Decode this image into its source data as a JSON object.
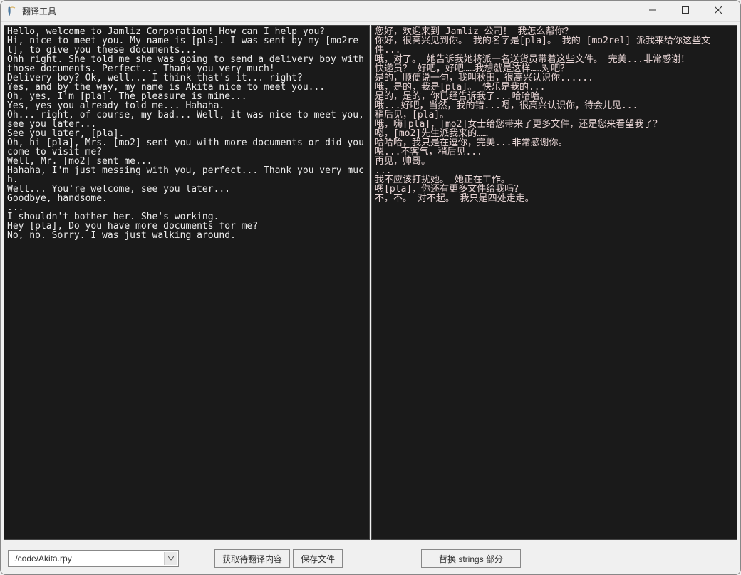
{
  "window": {
    "title": "翻译工具"
  },
  "panels": {
    "left_text": "Hello, welcome to Jamliz Corporation! How can I help you?\nHi, nice to meet you. My name is [pla]. I was sent by my [mo2rel], to give you these documents...\nOhh right. She told me she was going to send a delivery boy with those documents. Perfect... Thank you very much!\nDelivery boy? Ok, well... I think that's it... right?\nYes, and by the way, my name is Akita nice to meet you...\nOh, yes, I'm [pla]. The pleasure is mine...\nYes, yes you already told me... Hahaha.\nOh... right, of course, my bad... Well, it was nice to meet you, see you later...\nSee you later, [pla].\nOh, hi [pla], Mrs. [mo2] sent you with more documents or did you come to visit me?\nWell, Mr. [mo2] sent me...\nHahaha, I'm just messing with you, perfect... Thank you very much.\nWell... You're welcome, see you later...\nGoodbye, handsome.\n...\nI shouldn't bother her. She's working.\nHey [pla], Do you have more documents for me?\nNo, no. Sorry. I was just walking around.",
    "right_text": "您好，欢迎来到 Jamliz 公司！ 我怎么帮你？\n你好，很高兴见到你。 我的名字是[pla]。 我的 [mo2rel] 派我来给你这些文件...\n哦，对了。 她告诉我她将派一名送货员带着这些文件。 完美...非常感谢！\n快递员？ 好吧，好吧……我想就是这样……对吧？\n是的，顺便说一句，我叫秋田，很高兴认识你......\n哦，是的，我是[pla]。 快乐是我的...\n是的，是的，你已经告诉我了...哈哈哈。\n哦...好吧，当然，我的错...嗯，很高兴认识你，待会儿见...\n稍后见，[pla]。\n哦，嗨[pla]，[mo2]女士给您带来了更多文件，还是您来看望我了？\n嗯，[mo2]先生派我来的……\n哈哈哈，我只是在逗你，完美...非常感谢你。\n嗯...不客气，稍后见...\n再见，帅哥。\n...\n我不应该打扰她。 她正在工作。\n嘿[pla]，你还有更多文件给我吗？\n不，不。 对不起。 我只是四处走走。"
  },
  "bottom": {
    "file_path": "./code/Akita.rpy",
    "btn_fetch": "获取待翻译内容",
    "btn_save": "保存文件",
    "btn_replace": "替换 strings 部分"
  }
}
